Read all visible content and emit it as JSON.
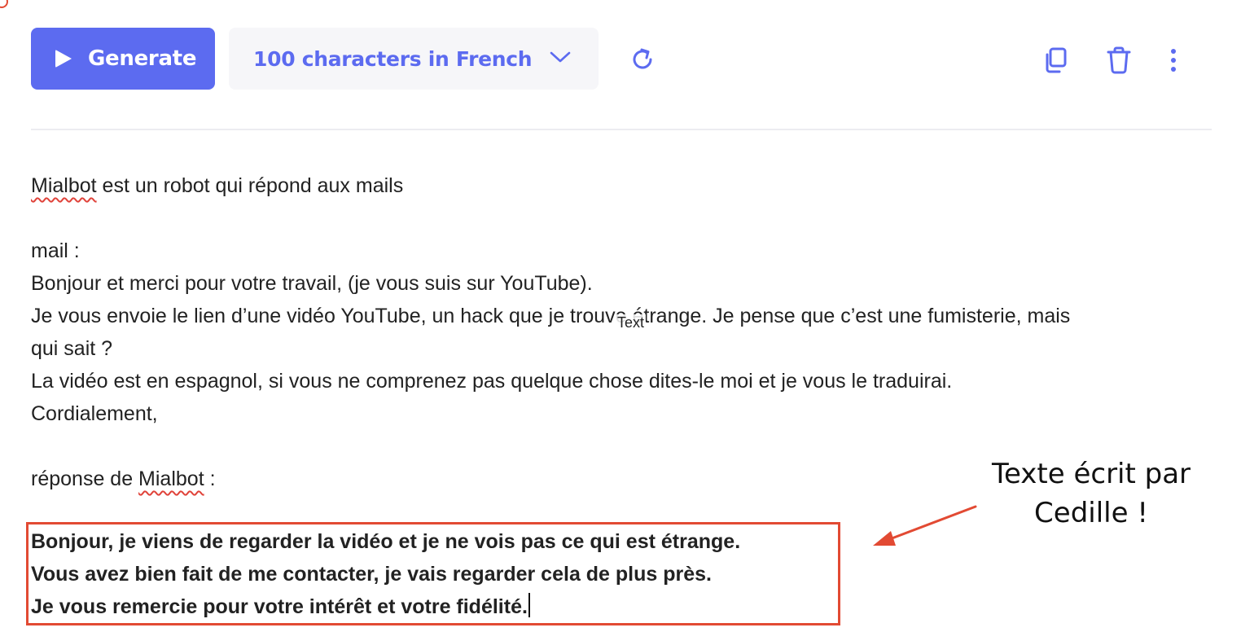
{
  "toolbar": {
    "generate_label": "Generate",
    "mode_label": "100 characters in French",
    "icons": [
      "play-icon",
      "chevron-down-icon",
      "refresh-icon",
      "copy-icon",
      "trash-icon",
      "more-vertical-icon"
    ]
  },
  "editor": {
    "prompt_line": {
      "name": "Mialbot",
      "rest": " est un robot qui répond aux mails"
    },
    "mail_label": "mail :",
    "mail_lines": [
      "Bonjour et merci pour votre travail, (je vous suis sur YouTube).",
      "Je vous envoie le lien d’une vidéo YouTube, un hack que je trouve étrange. Je pense que c’est une fumisterie, mais",
      "qui sait ?",
      "La vidéo est en espagnol, si vous ne comprenez pas quelque chose dites-le moi et je vous le traduirai.",
      "Cordialement,"
    ],
    "reply_label": {
      "before": "réponse de ",
      "name": "Mialbot",
      "after": " :"
    }
  },
  "response": {
    "lines": [
      "Bonjour, je viens de regarder la vidéo et je ne vois pas ce qui est étrange.",
      "Vous avez bien fait de me contacter, je vais regarder cela de plus près.",
      "Je vous remercie pour votre intérêt et votre fidélité."
    ]
  },
  "cursor_tooltip": "Text",
  "annotation": {
    "line1": "Texte écrit par",
    "line2": "Cedille !"
  },
  "colors": {
    "accent": "#5c6bf0",
    "annotation_red": "#e24a33",
    "text": "#222222",
    "select_bg": "#f6f6f9"
  }
}
